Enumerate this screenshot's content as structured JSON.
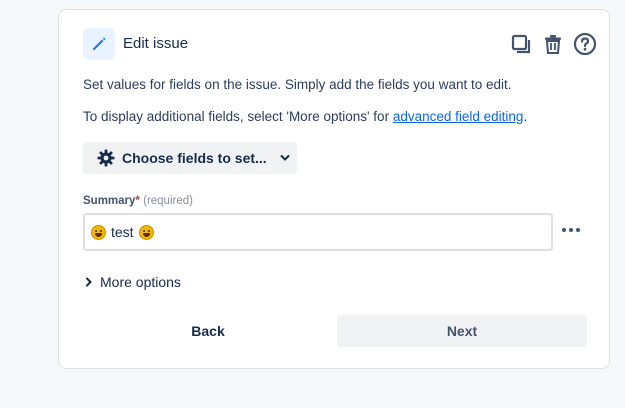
{
  "header": {
    "title": "Edit issue",
    "icons": [
      "pencil-icon",
      "copy-icon",
      "trash-icon",
      "help-icon"
    ]
  },
  "description": {
    "line1": "Set values for fields on the issue. Simply add the fields you want to edit.",
    "line2_prefix": "To display additional fields, select 'More options' for ",
    "line2_link": "advanced field editing",
    "line2_suffix": "."
  },
  "choose_fields": {
    "label": "Choose fields to set...",
    "icon": "gear-icon"
  },
  "summary": {
    "label": "Summary",
    "required_mark": "*",
    "required_text": "(required)",
    "value": "test"
  },
  "more_options": {
    "label": "More options"
  },
  "footer": {
    "back_label": "Back",
    "next_label": "Next"
  },
  "colors": {
    "accent": "#0c66e4",
    "text": "#172b4d",
    "button_bg": "#f1f2f4",
    "required": "#c9372c"
  }
}
